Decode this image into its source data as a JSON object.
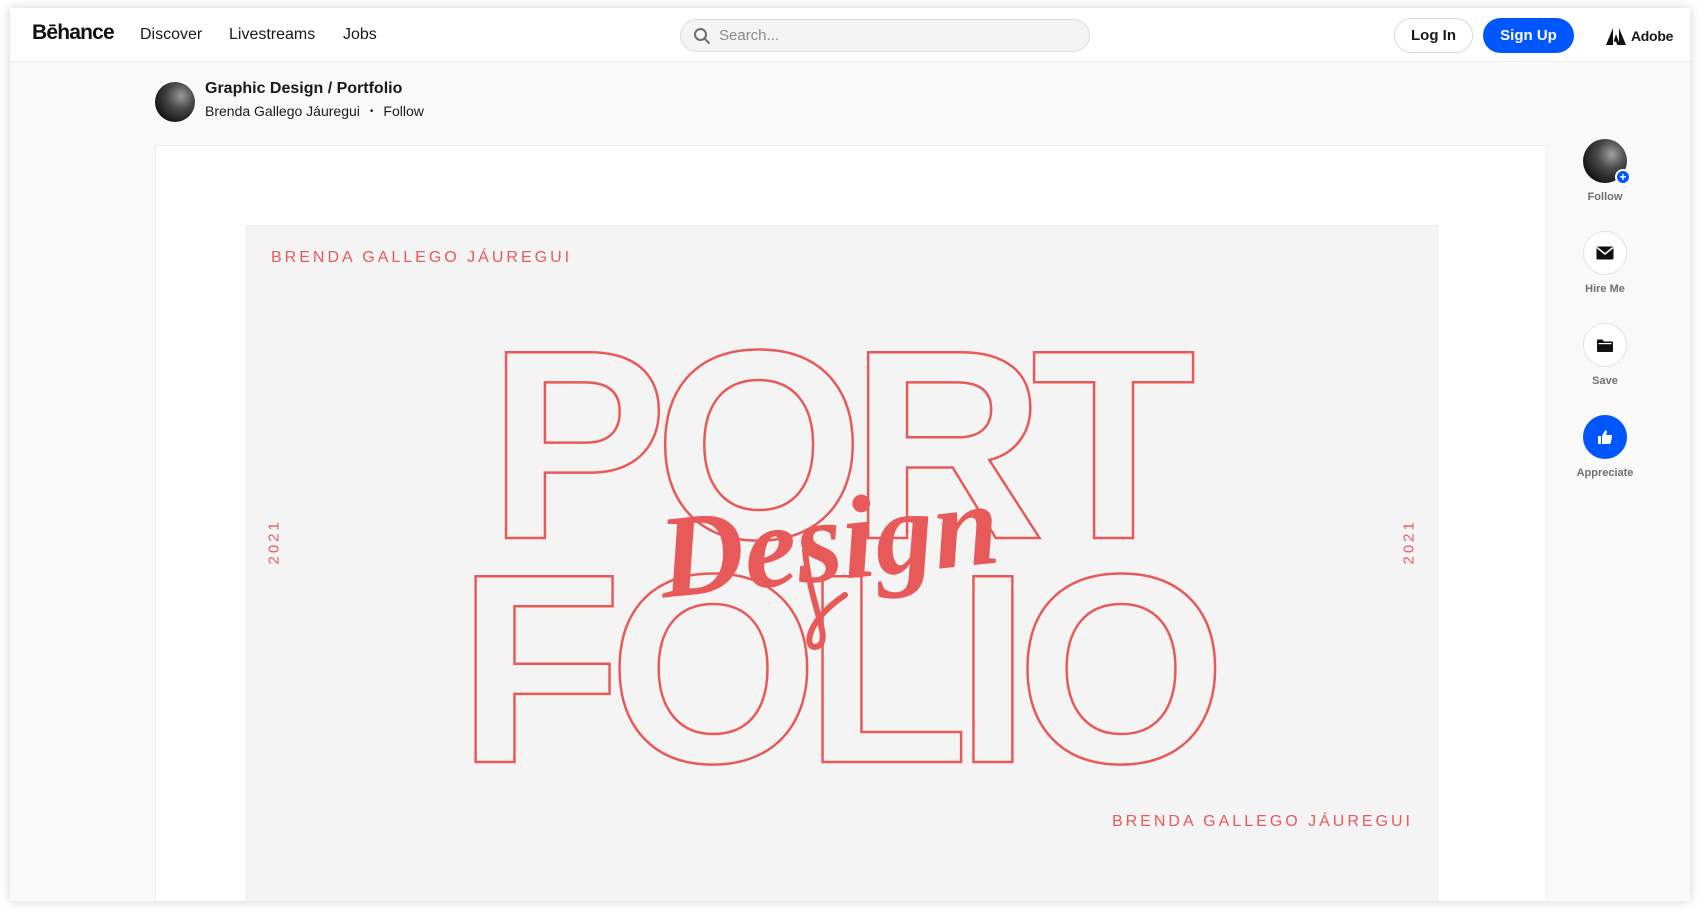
{
  "header": {
    "logo": "Bēhance",
    "nav": [
      "Discover",
      "Livestreams",
      "Jobs"
    ],
    "search_placeholder": "Search...",
    "login_label": "Log In",
    "signup_label": "Sign Up",
    "adobe_label": "Adobe"
  },
  "project": {
    "title": "Graphic Design / Portfolio",
    "owner": "Brenda Gallego Jáuregui",
    "separator": "•",
    "follow_label": "Follow"
  },
  "artwork": {
    "name_top": "BRENDA GALLEGO JÁUREGUI",
    "name_bottom": "BRENDA GALLEGO JÁUREGUI",
    "year_left": "2021",
    "year_right": "2021",
    "word_top": "PORT",
    "word_bottom": "FOLIO",
    "script_word": "Design",
    "accent_color": "#e85a5a"
  },
  "rail": {
    "follow_label": "Follow",
    "hire_label": "Hire Me",
    "save_label": "Save",
    "appreciate_label": "Appreciate"
  },
  "colors": {
    "brand_blue": "#0057ff",
    "page_bg": "#f9f9f9",
    "art_bg": "#f4f4f4"
  }
}
